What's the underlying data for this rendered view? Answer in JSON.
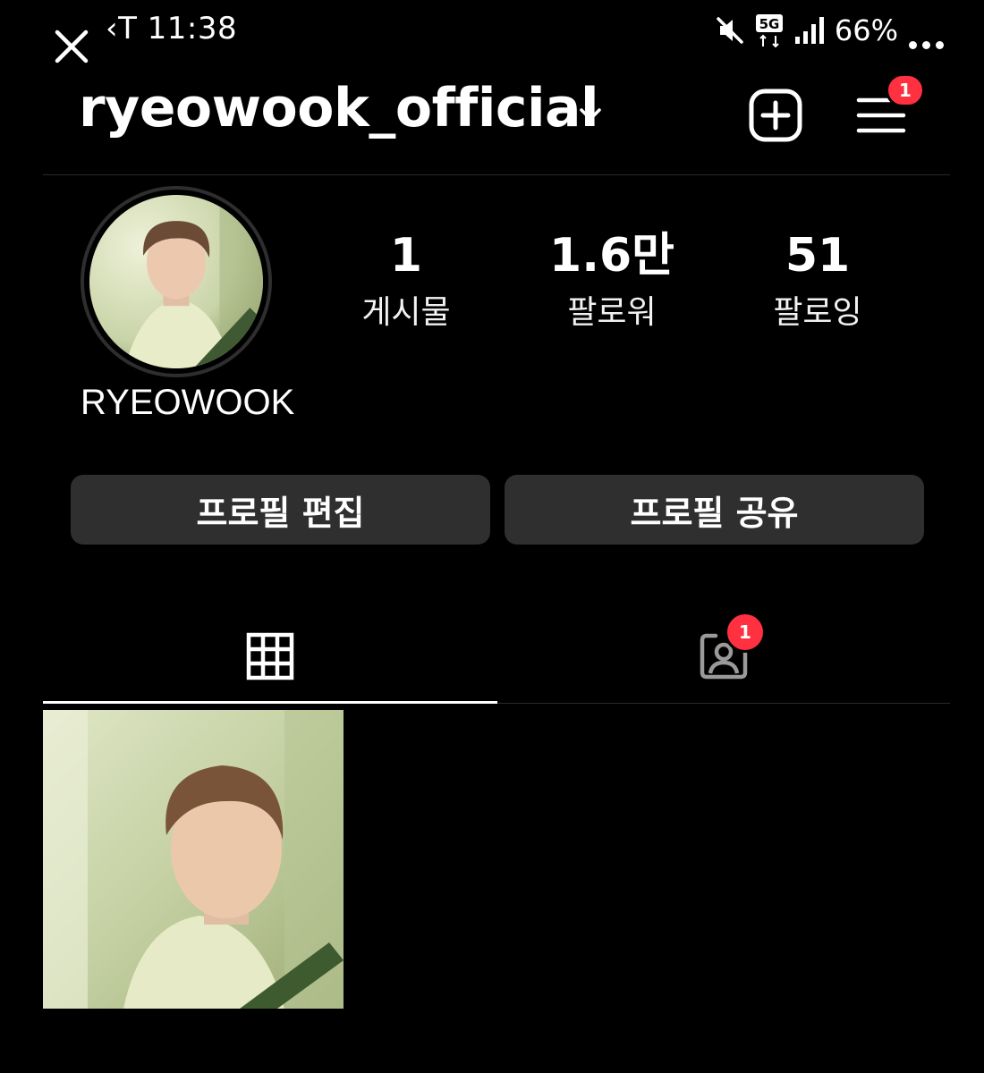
{
  "status_bar": {
    "time": "‹T 11:38",
    "battery": "66%",
    "network": "5G"
  },
  "header": {
    "username": "ryeowook_official",
    "menu_badge": "1"
  },
  "profile": {
    "display_name": "RYEOWOOK",
    "stats": [
      {
        "value": "1",
        "label": "게시물"
      },
      {
        "value": "1.6만",
        "label": "팔로워"
      },
      {
        "value": "51",
        "label": "팔로잉"
      }
    ]
  },
  "actions": {
    "edit_profile": "프로필 편집",
    "share_profile": "프로필 공유"
  },
  "tabs": {
    "tagged_badge": "1"
  },
  "colors": {
    "background": "#000000",
    "button_bg": "#2f2f2f",
    "badge": "#ff3040"
  },
  "icons": [
    "close-icon",
    "mute-icon",
    "signal-icon",
    "more-icon",
    "chevron-down-icon",
    "add-icon",
    "menu-icon",
    "grid-icon",
    "tagged-icon"
  ]
}
